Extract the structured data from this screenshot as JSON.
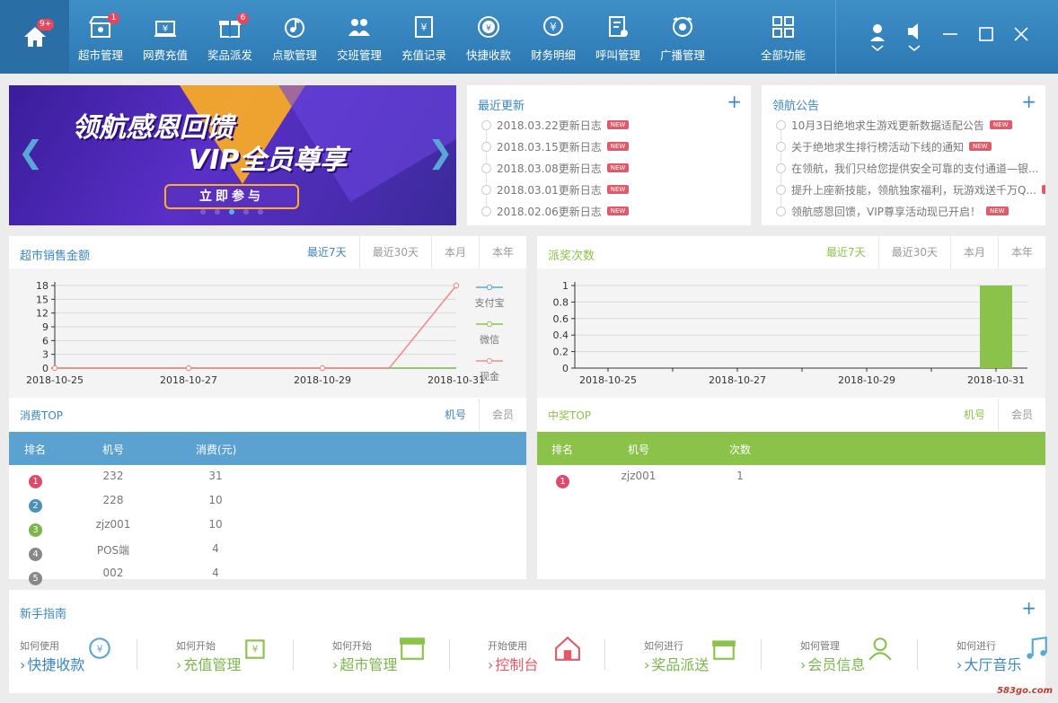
{
  "nav": {
    "home_badge": "9+",
    "items": [
      {
        "label": "超市管理",
        "icon": "supermarket-icon",
        "badge": "1"
      },
      {
        "label": "网费充值",
        "icon": "recharge-icon",
        "badge": ""
      },
      {
        "label": "奖品派发",
        "icon": "gift-icon",
        "badge": "6"
      },
      {
        "label": "点歌管理",
        "icon": "music-icon",
        "badge": ""
      },
      {
        "label": "交班管理",
        "icon": "handover-icon",
        "badge": ""
      },
      {
        "label": "充值记录",
        "icon": "record-icon",
        "badge": ""
      },
      {
        "label": "快捷收款",
        "icon": "quick-pay-icon",
        "badge": ""
      },
      {
        "label": "财务明细",
        "icon": "finance-icon",
        "badge": ""
      },
      {
        "label": "呼叫管理",
        "icon": "call-icon",
        "badge": ""
      },
      {
        "label": "广播管理",
        "icon": "broadcast-icon",
        "badge": ""
      },
      {
        "label": "全部功能",
        "icon": "all-functions-icon",
        "badge": ""
      }
    ]
  },
  "banner": {
    "line1": "领航感恩回馈",
    "line2": "VIP全员尊享",
    "button": "立即参与"
  },
  "updates": {
    "title": "最近更新",
    "new_tag": "NEW",
    "items": [
      "2018.03.22更新日志",
      "2018.03.15更新日志",
      "2018.03.08更新日志",
      "2018.03.01更新日志",
      "2018.02.06更新日志"
    ]
  },
  "notices": {
    "title": "领航公告",
    "items": [
      "10月3日绝地求生游戏更新数据适配公告",
      "关于绝地求生排行榜活动下线的通知",
      "在领航，我们只给您提供安全可靠的支付通道—银...",
      "提升上座新技能，领航独家福利，玩游戏送千万Q...",
      "领航感恩回馈，VIP尊享活动现已开启！"
    ],
    "new_flags": [
      true,
      true,
      false,
      true,
      true
    ]
  },
  "sales": {
    "title": "超市销售金额",
    "tabs": [
      "最近7天",
      "最近30天",
      "本月",
      "本年"
    ],
    "legend": [
      "支付宝",
      "微信",
      "现金"
    ]
  },
  "prize": {
    "title": "派奖次数",
    "tabs": [
      "最近7天",
      "最近30天",
      "本月",
      "本年"
    ]
  },
  "chart_data": [
    {
      "type": "line",
      "title": "超市销售金额",
      "x": [
        "2018-10-25",
        "2018-10-26",
        "2018-10-27",
        "2018-10-28",
        "2018-10-29",
        "2018-10-30",
        "2018-10-31"
      ],
      "xticks": [
        "2018-10-25",
        "2018-10-27",
        "2018-10-29",
        "2018-10-31"
      ],
      "yticks": [
        0,
        3,
        6,
        9,
        12,
        15,
        18
      ],
      "ylim": [
        0,
        18
      ],
      "grid": true,
      "legend_position": "right",
      "series": [
        {
          "name": "支付宝",
          "color": "#5aa6d6",
          "values": [
            0,
            0,
            0,
            0,
            0,
            0,
            0
          ]
        },
        {
          "name": "微信",
          "color": "#8bc34a",
          "values": [
            0,
            0,
            0,
            0,
            0,
            0,
            0
          ]
        },
        {
          "name": "现金",
          "color": "#f08c8c",
          "values": [
            0,
            0,
            0,
            0,
            0,
            0,
            18
          ]
        }
      ]
    },
    {
      "type": "bar",
      "title": "派奖次数",
      "categories": [
        "2018-10-25",
        "2018-10-26",
        "2018-10-27",
        "2018-10-28",
        "2018-10-29",
        "2018-10-30",
        "2018-10-31"
      ],
      "xticks": [
        "2018-10-25",
        "2018-10-27",
        "2018-10-29",
        "2018-10-31"
      ],
      "yticks": [
        "0",
        "0.2",
        "0.4",
        "0.6",
        "0.8",
        "1"
      ],
      "values": [
        0,
        0,
        0,
        0,
        0,
        0,
        1
      ],
      "ylim": [
        0,
        1
      ],
      "grid": true,
      "color": "#8bc34a"
    }
  ],
  "consume_top": {
    "title": "消费TOP",
    "tabs": [
      "机号",
      "会员"
    ],
    "headers": [
      "排名",
      "机号",
      "消费(元)"
    ],
    "rows": [
      {
        "rank": "1",
        "machine": "232",
        "value": "31"
      },
      {
        "rank": "2",
        "machine": "228",
        "value": "10"
      },
      {
        "rank": "3",
        "machine": "zjz001",
        "value": "10"
      },
      {
        "rank": "4",
        "machine": "POS端",
        "value": "4"
      },
      {
        "rank": "5",
        "machine": "002",
        "value": "4"
      }
    ],
    "rank_colors": [
      "#e04a6a",
      "#4a90b8",
      "#7ab648",
      "#888888",
      "#888888"
    ]
  },
  "prize_top": {
    "title": "中奖TOP",
    "tabs": [
      "机号",
      "会员"
    ],
    "headers": [
      "排名",
      "机号",
      "次数"
    ],
    "rows": [
      {
        "rank": "1",
        "machine": "zjz001",
        "value": "1"
      }
    ]
  },
  "guide": {
    "title": "新手指南",
    "items": [
      {
        "pre": "如何使用",
        "main": "快捷收款",
        "icon": "quick-pay-icon"
      },
      {
        "pre": "如何开始",
        "main": "充值管理",
        "icon": "recharge-icon"
      },
      {
        "pre": "如何开始",
        "main": "超市管理",
        "icon": "supermarket-icon"
      },
      {
        "pre": "开始使用",
        "main": "控制台",
        "icon": "console-icon"
      },
      {
        "pre": "如何进行",
        "main": "奖品派送",
        "icon": "gift-icon"
      },
      {
        "pre": "如何管理",
        "main": "会员信息",
        "icon": "member-icon"
      },
      {
        "pre": "如何进行",
        "main": "大厅音乐",
        "icon": "music-icon"
      }
    ]
  },
  "watermark": "583go.com"
}
